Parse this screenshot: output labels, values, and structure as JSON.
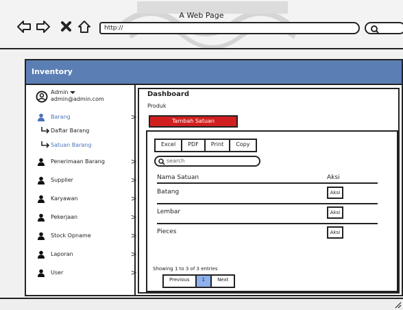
{
  "browser": {
    "title": "A Web Page",
    "url": "http://",
    "nav_icons": [
      "back-arrow-icon",
      "forward-arrow-icon",
      "close-icon",
      "home-icon"
    ]
  },
  "app": {
    "header": "Inventory",
    "header_color": "#5b7fb5",
    "user": {
      "name": "Admin",
      "email": "admin@admin.com"
    }
  },
  "sidebar": {
    "items": [
      {
        "label": "Barang",
        "icon": "person-icon",
        "active": true,
        "children": [
          {
            "label": "Daftar Barang",
            "active": false
          },
          {
            "label": "Satuan Barang",
            "active": true
          }
        ]
      },
      {
        "label": "Penerimaan Barang",
        "icon": "person-icon"
      },
      {
        "label": "Supplier",
        "icon": "person-icon"
      },
      {
        "label": "Karyawan",
        "icon": "person-icon"
      },
      {
        "label": "Pekerjaan",
        "icon": "person-icon"
      },
      {
        "label": "Stock Opname",
        "icon": "person-icon"
      },
      {
        "label": "Laporan",
        "icon": "person-icon"
      },
      {
        "label": "User",
        "icon": "person-icon"
      }
    ],
    "chevron": ">"
  },
  "main": {
    "title": "Dashboard",
    "subtitle": "Produk",
    "add_button": "Tambah Satuan",
    "add_button_color": "#d11f1f",
    "export_buttons": [
      "Excel",
      "PDF",
      "Print",
      "Copy"
    ],
    "search_placeholder": "search",
    "table": {
      "columns": [
        "Nama Satuan",
        "Aksi"
      ],
      "rows": [
        {
          "name": "Batang",
          "action": "Aksi"
        },
        {
          "name": "Lembar",
          "action": "Aksi"
        },
        {
          "name": "Pieces",
          "action": "Aksi"
        }
      ]
    },
    "info": "Showing 1 to 3 of 3 entries",
    "pagination": {
      "previous": "Previous",
      "current": "1",
      "next": "Next"
    },
    "active_page_color": "#8db0ee"
  }
}
